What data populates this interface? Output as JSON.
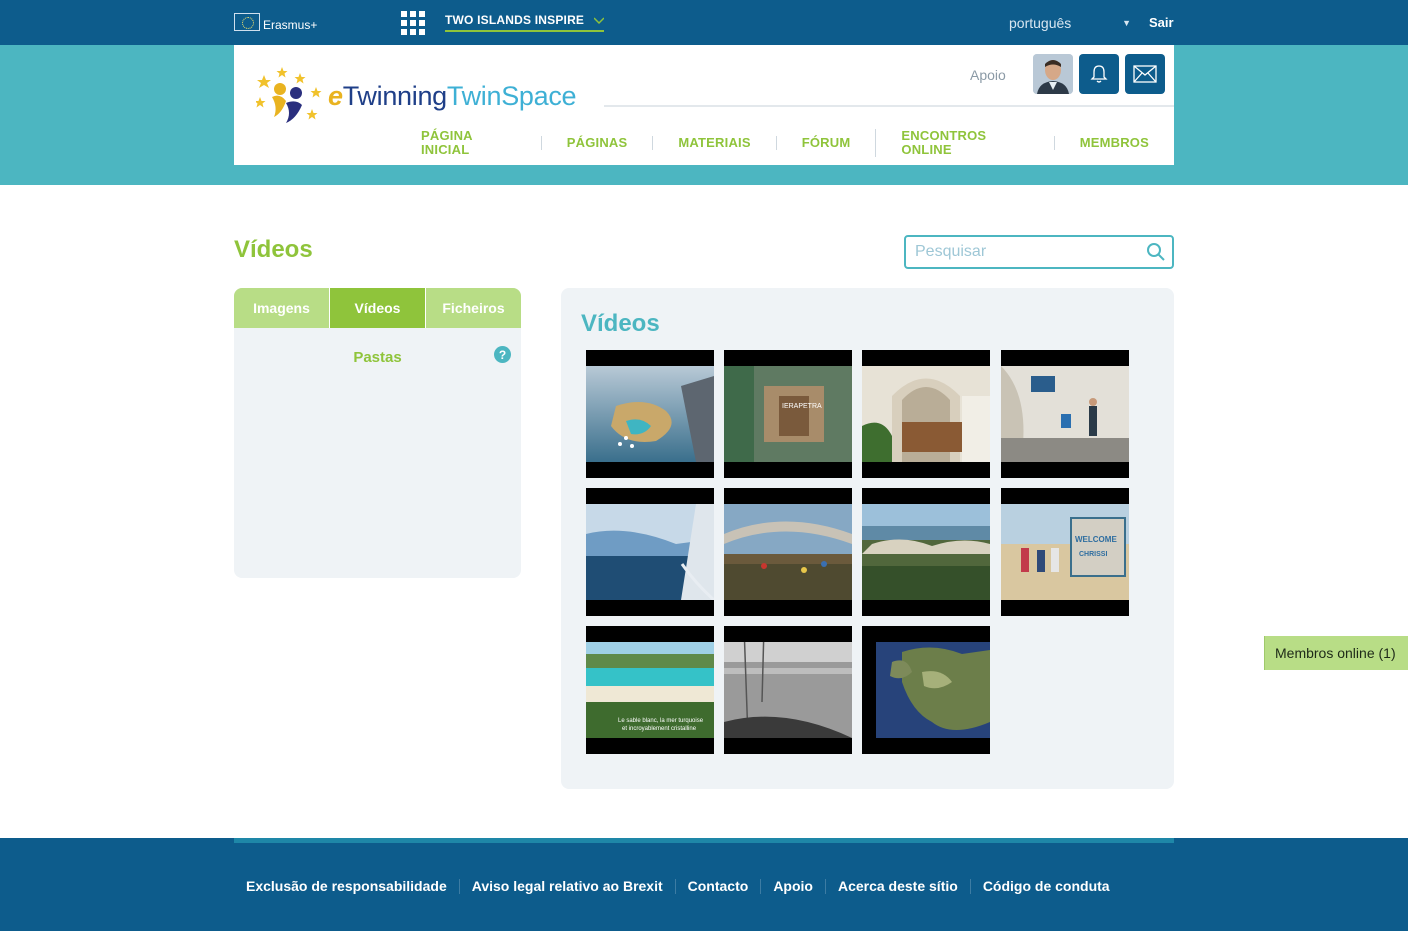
{
  "topbar": {
    "erasmus_label": "Erasmus+",
    "project_name": "TWO ISLANDS INSPIRE",
    "language": "português",
    "logout_label": "Sair"
  },
  "header": {
    "logo_e": "e",
    "logo_twinning": "Twinning",
    "logo_twinspace": "TwinSpace",
    "support_label": "Apoio",
    "nav": [
      "PÁGINA INICIAL",
      "PÁGINAS",
      "MATERIAIS",
      "FÓRUM",
      "ENCONTROS ONLINE",
      "MEMBROS"
    ]
  },
  "page": {
    "title": "Vídeos",
    "search_placeholder": "Pesquisar"
  },
  "left_panel": {
    "tabs": [
      {
        "label": "Imagens",
        "active": false
      },
      {
        "label": "Vídeos",
        "active": true
      },
      {
        "label": "Ficheiros",
        "active": false
      }
    ],
    "folders_label": "Pastas",
    "help_glyph": "?"
  },
  "video_panel": {
    "heading": "Vídeos",
    "videos": [
      {
        "caption": ""
      },
      {
        "caption": "IERAPETRA"
      },
      {
        "caption": ""
      },
      {
        "caption": ""
      },
      {
        "caption": ""
      },
      {
        "caption": ""
      },
      {
        "caption": ""
      },
      {
        "caption": "WELCOME TO CHRISSI ISLAND"
      },
      {
        "caption": "Le sable blanc, la mer turquoise et incroyablement cristalline"
      },
      {
        "caption": ""
      },
      {
        "caption": ""
      }
    ]
  },
  "online_members": "Membros online (1)",
  "footer": {
    "links": [
      "Exclusão de responsabilidade",
      "Aviso legal relativo ao Brexit",
      "Contacto",
      "Apoio",
      "Acerca deste sítio",
      "Código de conduta"
    ]
  },
  "colors": {
    "brand_dark": "#0d5c8c",
    "teal": "#4cb6c1",
    "green": "#8fc43b",
    "green_light": "#b8dd86",
    "panel": "#eff3f6"
  }
}
